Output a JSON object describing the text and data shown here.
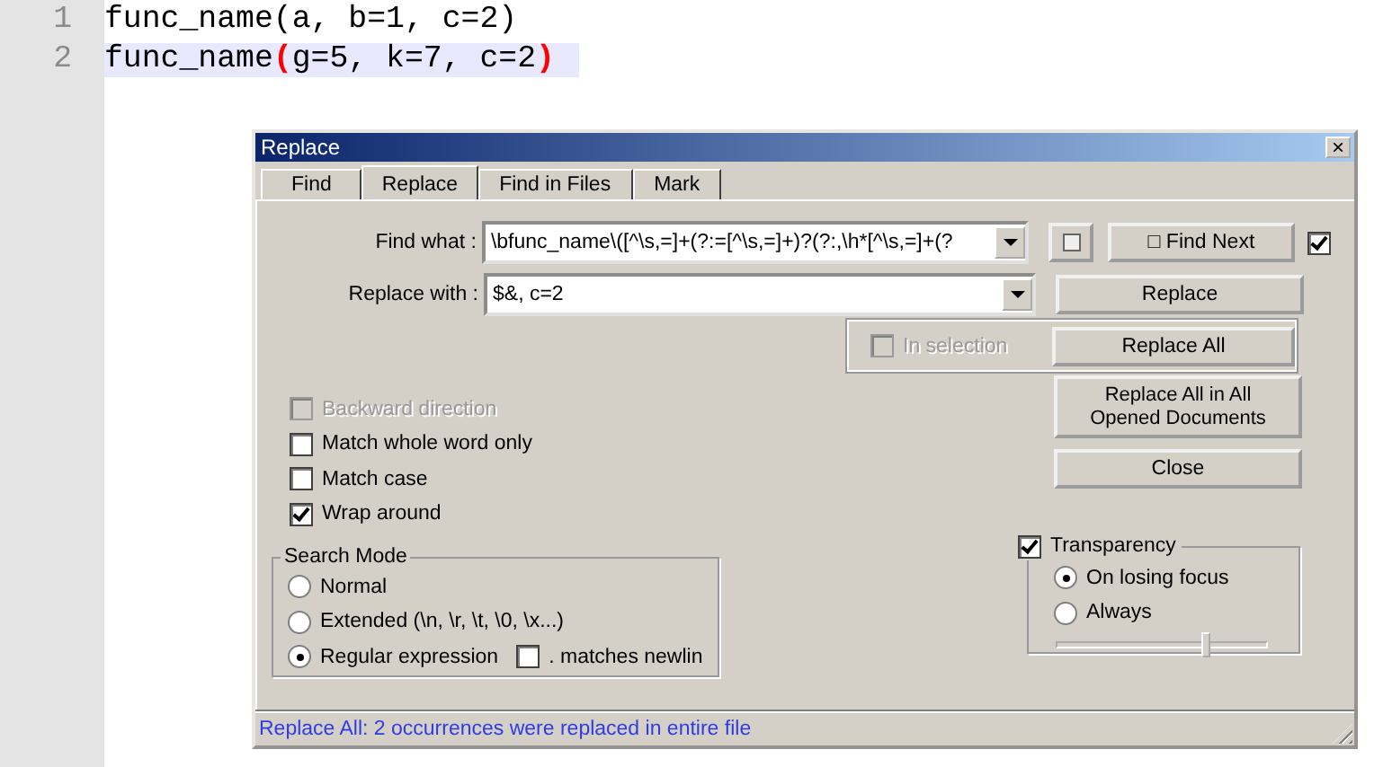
{
  "editor": {
    "lines": [
      {
        "number": "1",
        "current": false,
        "segments": [
          {
            "kind": "text",
            "text": "func_name(a, b=1, c=2)"
          }
        ]
      },
      {
        "number": "2",
        "current": true,
        "segments": [
          {
            "kind": "text",
            "text": "func_name"
          },
          {
            "kind": "brace",
            "text": "("
          },
          {
            "kind": "text",
            "text": "g=5, k=7, c=2"
          },
          {
            "kind": "brace",
            "text": ")"
          }
        ]
      }
    ]
  },
  "dialog": {
    "title": "Replace",
    "close": "×",
    "tabs": [
      {
        "label": "Find",
        "selected": false
      },
      {
        "label": "Replace",
        "selected": true
      },
      {
        "label": "Find in Files",
        "selected": false
      },
      {
        "label": "Mark",
        "selected": false
      }
    ],
    "find_what": {
      "label": "Find what :",
      "value": "\\bfunc_name\\([^\\s,=]+(?:=[^\\s,=]+)?(?:,\\h*[^\\s,=]+(?"
    },
    "replace_with": {
      "label": "Replace with :",
      "value": "$&, c=2"
    },
    "find_next": {
      "label": "□ Find Next"
    },
    "find_next_toggle": {
      "checked": true
    },
    "replace_button": "Replace",
    "in_selection": {
      "label": "In selection",
      "checked": false,
      "disabled": true
    },
    "replace_all": "Replace All",
    "replace_all_docs": "Replace All in All Opened Documents",
    "close_button": "Close",
    "options": [
      {
        "label": "Backward direction",
        "checked": false,
        "disabled": true
      },
      {
        "label": "Match whole word only",
        "checked": false,
        "disabled": false
      },
      {
        "label": "Match case",
        "checked": false,
        "disabled": false
      },
      {
        "label": "Wrap around",
        "checked": true,
        "disabled": false
      }
    ],
    "search_mode": {
      "title": "Search Mode",
      "options": [
        {
          "label": "Normal",
          "selected": false
        },
        {
          "label": "Extended (\\n, \\r, \\t, \\0, \\x...)",
          "selected": false
        },
        {
          "label": "Regular expression",
          "selected": true
        }
      ],
      "dot_newline": {
        "label": ". matches newlin",
        "checked": false
      }
    },
    "transparency": {
      "label": "Transparency",
      "checked": true,
      "options": [
        {
          "label": "On losing focus",
          "selected": true
        },
        {
          "label": "Always",
          "selected": false
        }
      ],
      "level": 0.71
    },
    "status": "Replace All: 2 occurrences were replaced in entire file"
  }
}
